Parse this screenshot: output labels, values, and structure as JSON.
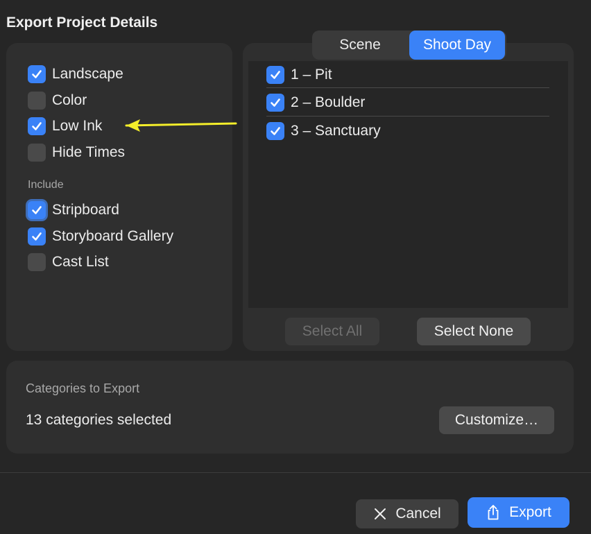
{
  "dialog": {
    "title": "Export Project Details"
  },
  "options": [
    {
      "label": "Landscape",
      "checked": true
    },
    {
      "label": "Color",
      "checked": false
    },
    {
      "label": "Low Ink",
      "checked": true
    },
    {
      "label": "Hide Times",
      "checked": false
    }
  ],
  "include": {
    "label": "Include",
    "items": [
      {
        "label": "Stripboard",
        "checked": true
      },
      {
        "label": "Storyboard Gallery",
        "checked": true
      },
      {
        "label": "Cast List",
        "checked": false
      }
    ]
  },
  "segment": {
    "options": [
      "Scene",
      "Shoot Day"
    ],
    "selected": "Shoot Day"
  },
  "shoot_days": [
    {
      "label": "1 – Pit",
      "checked": true
    },
    {
      "label": "2 – Boulder",
      "checked": true
    },
    {
      "label": "3 – Sanctuary",
      "checked": true
    }
  ],
  "list_buttons": {
    "select_all": "Select All",
    "select_none": "Select None"
  },
  "categories": {
    "label": "Categories to Export",
    "value": "13 categories selected",
    "customize": "Customize…"
  },
  "footer": {
    "cancel": "Cancel",
    "export": "Export"
  },
  "colors": {
    "accent": "#3a82f7",
    "annotation_arrow": "#f4ee2a"
  },
  "icons": {
    "checkbox": "checkmark-icon",
    "cancel": "close-icon",
    "export": "share-icon"
  }
}
